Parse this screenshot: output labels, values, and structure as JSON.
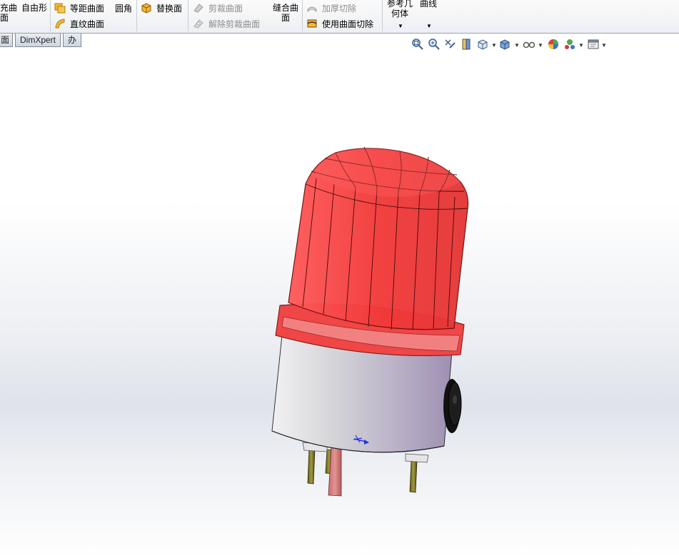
{
  "ribbon": {
    "fill_surface_label_line1": "充曲",
    "fill_surface_label_line2": "面",
    "freeform_label": "自由形",
    "offset_surface_label": "等距曲面",
    "ruled_surface_label": "直纹曲面",
    "fillet_label": "圆角",
    "replace_face_label": "替换面",
    "trim_surface_label": "剪裁曲面",
    "untrim_surface_label": "解除剪裁曲面",
    "knit_surface_label_line1": "缝合曲",
    "knit_surface_label_line2": "面",
    "thicken_cut_label": "加厚切除",
    "cut_with_surface_label": "使用曲面切除",
    "ref_geometry_label_line1": "参考几",
    "ref_geometry_label_line2": "何体",
    "curves_label": "曲线"
  },
  "tabs": [
    {
      "label": "面"
    },
    {
      "label": "DimXpert"
    },
    {
      "label": "办公室产品"
    }
  ],
  "headsup": {
    "icons": [
      "zoom-to-fit-icon",
      "zoom-to-area-icon",
      "previous-view-icon",
      "section-view-icon",
      "view-orientation-icon",
      "display-style-icon",
      "hide-show-items-icon",
      "edit-appearance-icon",
      "apply-scene-icon",
      "view-settings-icon"
    ]
  },
  "colors": {
    "lens_red": "#f23a3a",
    "body_gray": "#c9c9cf",
    "viewport_bg": "#e8ebf0",
    "triad_blue": "#2233dd"
  }
}
